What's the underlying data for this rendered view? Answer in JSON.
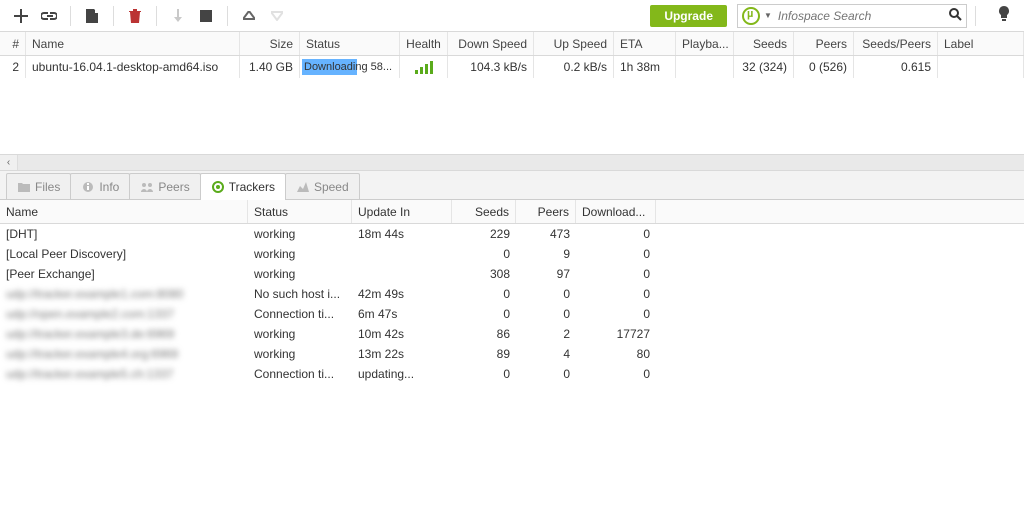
{
  "toolbar": {
    "upgrade_label": "Upgrade",
    "search_placeholder": "Infospace Search"
  },
  "torrent_columns": {
    "num": "#",
    "name": "Name",
    "size": "Size",
    "status": "Status",
    "health": "Health",
    "down": "Down Speed",
    "up": "Up Speed",
    "eta": "ETA",
    "playba": "Playba...",
    "seeds": "Seeds",
    "peers": "Peers",
    "sp": "Seeds/Peers",
    "label": "Label"
  },
  "torrent_row": {
    "num": "2",
    "name": "ubuntu-16.04.1-desktop-amd64.iso",
    "size": "1.40 GB",
    "status_text": "Downloading 58...",
    "status_pct": 58,
    "down": "104.3 kB/s",
    "up": "0.2 kB/s",
    "eta": "1h 38m",
    "playba": "",
    "seeds": "32 (324)",
    "peers": "0 (526)",
    "sp": "0.615",
    "label": ""
  },
  "tabs": {
    "files": "Files",
    "info": "Info",
    "peers": "Peers",
    "trackers": "Trackers",
    "speed": "Speed"
  },
  "tracker_columns": {
    "name": "Name",
    "status": "Status",
    "update": "Update In",
    "seeds": "Seeds",
    "peers": "Peers",
    "down": "Download..."
  },
  "trackers": [
    {
      "name": "[DHT]",
      "status": "working",
      "update": "18m 44s",
      "seeds": "229",
      "peers": "473",
      "down": "0",
      "blur": false
    },
    {
      "name": "[Local Peer Discovery]",
      "status": "working",
      "update": "",
      "seeds": "0",
      "peers": "9",
      "down": "0",
      "blur": false
    },
    {
      "name": "[Peer Exchange]",
      "status": "working",
      "update": "",
      "seeds": "308",
      "peers": "97",
      "down": "0",
      "blur": false
    },
    {
      "name": "udp://tracker.example1.com:8080",
      "status": "No such host i...",
      "update": "42m 49s",
      "seeds": "0",
      "peers": "0",
      "down": "0",
      "blur": true
    },
    {
      "name": "udp://open.example2.com:1337",
      "status": "Connection ti...",
      "update": "6m 47s",
      "seeds": "0",
      "peers": "0",
      "down": "0",
      "blur": true
    },
    {
      "name": "udp://tracker.example3.de:6969",
      "status": "working",
      "update": "10m 42s",
      "seeds": "86",
      "peers": "2",
      "down": "17727",
      "blur": true
    },
    {
      "name": "udp://tracker.example4.org:6969",
      "status": "working",
      "update": "13m 22s",
      "seeds": "89",
      "peers": "4",
      "down": "80",
      "blur": true
    },
    {
      "name": "udp://tracker.example5.ch:1337",
      "status": "Connection ti...",
      "update": "updating...",
      "seeds": "0",
      "peers": "0",
      "down": "0",
      "blur": true
    }
  ]
}
